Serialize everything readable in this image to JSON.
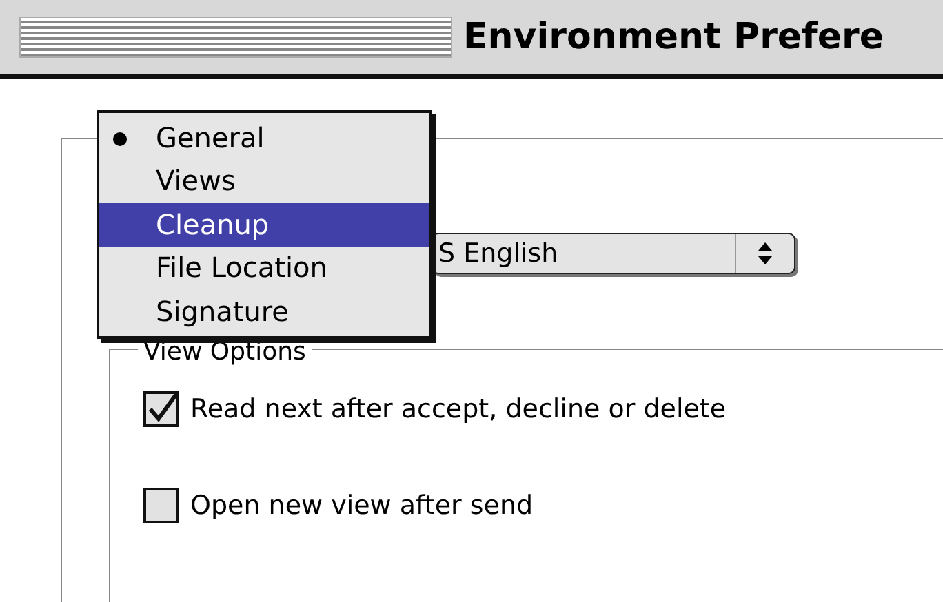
{
  "window": {
    "title": "Environment Prefere"
  },
  "popup_menu": {
    "items": [
      {
        "label": "General",
        "checked": true,
        "selected": false
      },
      {
        "label": "Views",
        "checked": false,
        "selected": false
      },
      {
        "label": "Cleanup",
        "checked": false,
        "selected": true
      },
      {
        "label": "File Location",
        "checked": false,
        "selected": false
      },
      {
        "label": "Signature",
        "checked": false,
        "selected": false
      }
    ]
  },
  "language_popup": {
    "value": "S English"
  },
  "view_options": {
    "title": "View Options",
    "options": [
      {
        "label": "Read next after accept, decline or delete",
        "checked": true
      },
      {
        "label": "Open new view after send",
        "checked": false
      }
    ]
  }
}
